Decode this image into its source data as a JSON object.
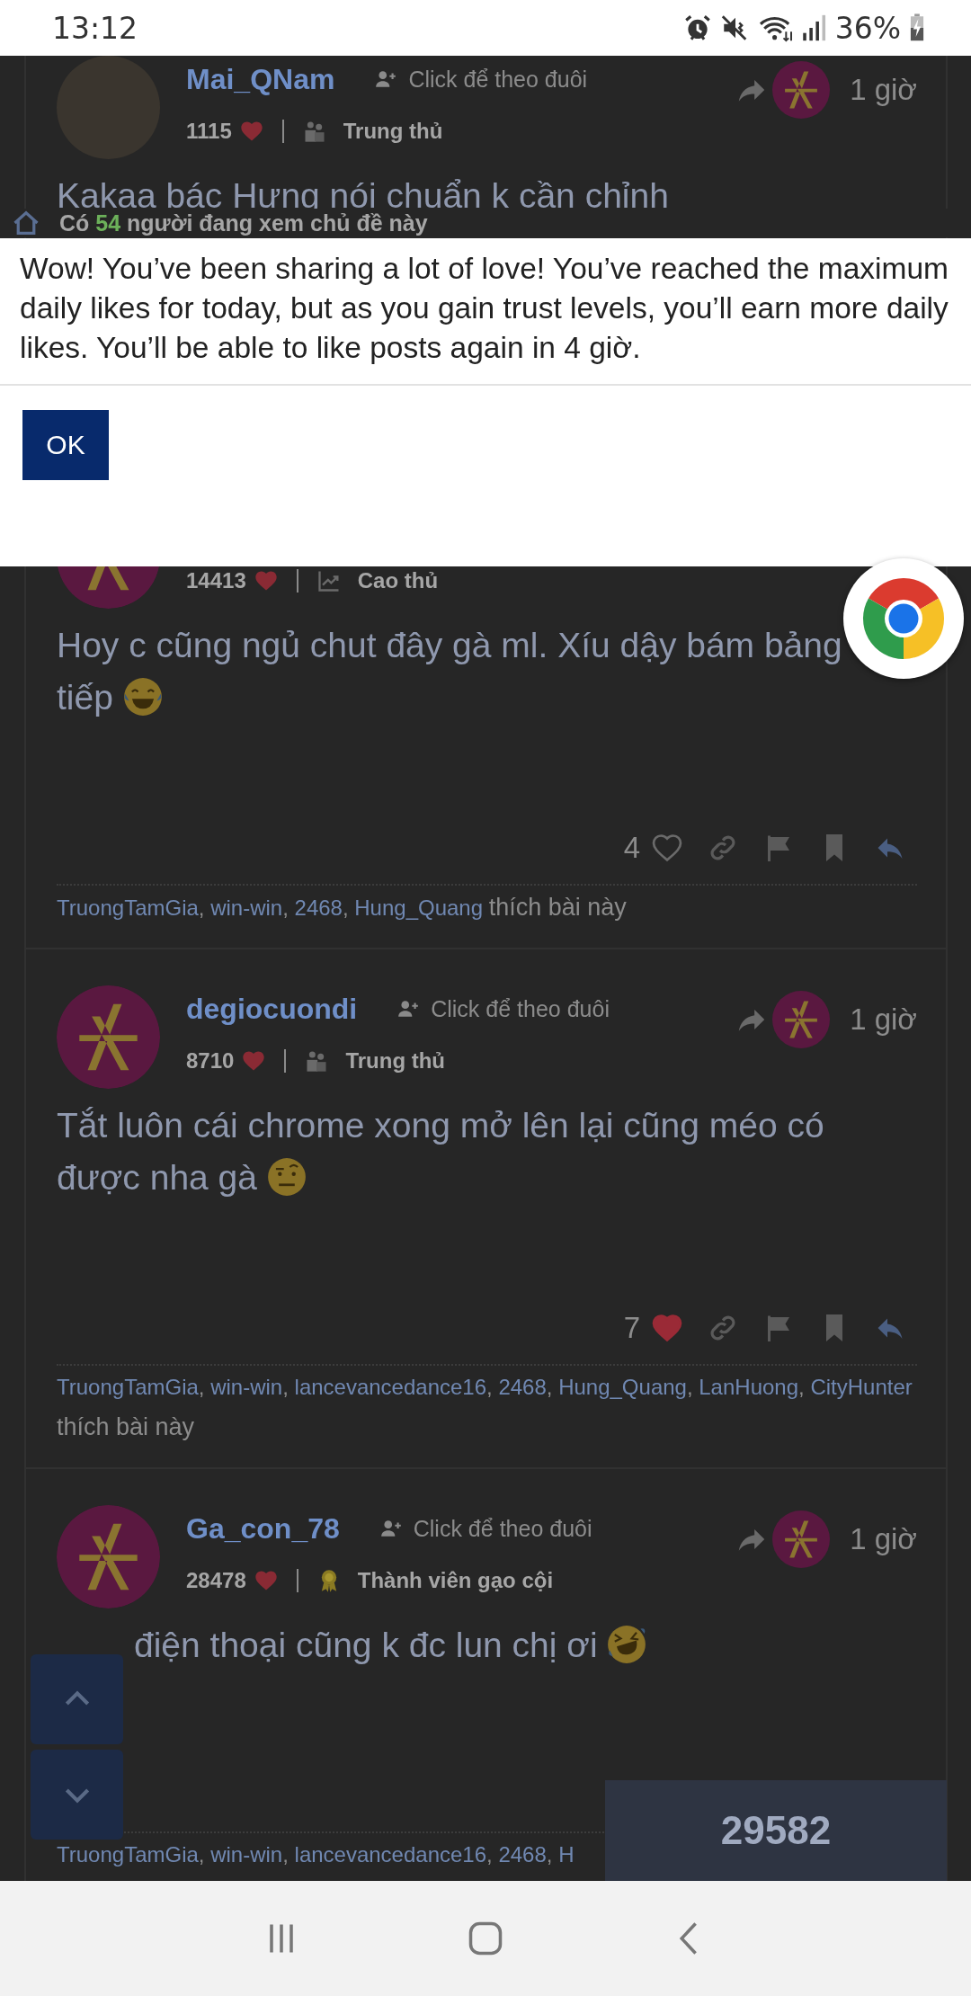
{
  "status_bar": {
    "time": "13:12",
    "battery": "36%"
  },
  "watching": {
    "prefix": "Có",
    "count": "54",
    "suffix": "người đang xem chủ đề này"
  },
  "likers_separator": ",",
  "posts": [
    {
      "avatar": {
        "kind": "photo"
      },
      "username": "Mai_QNam",
      "follow": "Click để theo đuôi",
      "time": "1 giờ",
      "likes_received": "1115",
      "rank": {
        "label": "Trung thủ",
        "kind": "group"
      },
      "text": "Kakaa bác Hưng nói chuẩn k cần chỉnh"
    },
    {
      "avatar": {
        "kind": "logo"
      },
      "likes_received": "14413",
      "rank": {
        "label": "Cao thủ",
        "kind": "chart"
      },
      "text": "Hoy c cũng ngủ chut đây gà ml. Xíu dậy bám bảng tiếp",
      "emoji": {
        "kind": "tears-of-joy"
      },
      "like_count": "4",
      "liked": false,
      "likers": [
        "TruongTamGia",
        "win-win",
        "2468",
        "Hung_Quang"
      ],
      "likers_suffix": "thích bài này"
    },
    {
      "avatar": {
        "kind": "logo"
      },
      "username": "degiocuondi",
      "follow": "Click để theo đuôi",
      "time": "1 giờ",
      "likes_received": "8710",
      "rank": {
        "label": "Trung thủ",
        "kind": "group"
      },
      "text": "Tắt luôn cái chrome xong mở lên lại cũng méo có được nha gà",
      "emoji": {
        "kind": "raised-eyebrow"
      },
      "like_count": "7",
      "liked": true,
      "likers": [
        "TruongTamGia",
        "win-win",
        "lancevancedance16",
        "2468",
        "Hung_Quang",
        "LanHuong",
        "CityHunter"
      ],
      "likers_suffix": "thích bài này"
    },
    {
      "avatar": {
        "kind": "logo"
      },
      "username": "Ga_con_78",
      "follow": "Click để theo đuôi",
      "time": "1 giờ",
      "likes_received": "28478",
      "rank": {
        "label": "Thành viên gạo cội",
        "kind": "award"
      },
      "text": "điện thoại cũng k đc lun chị ơi",
      "emoji": {
        "kind": "rolling-laughing"
      },
      "likers": [
        "TruongTamGia",
        "win-win",
        "lancevancedance16",
        "2468",
        "H"
      ]
    }
  ],
  "dialog": {
    "message": "Wow! You’ve been sharing a lot of love! You’ve reached the maximum daily likes for today, but as you gain trust levels, you’ll earn more daily likes. You’ll be able to like posts again in 4 giờ.",
    "button": "OK"
  },
  "counter": {
    "value": "29582"
  }
}
